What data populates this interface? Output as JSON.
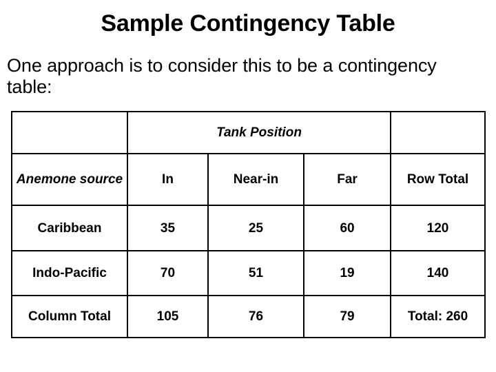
{
  "slide": {
    "title": "Sample Contingency Table",
    "body": "One approach is to consider this to be a contingency table:"
  },
  "accent_colors": {
    "total_red": "#cc1122",
    "text_black": "#000000",
    "border_black": "#000000",
    "background": "#ffffff"
  },
  "table": {
    "group_header": {
      "corner": "",
      "tank_position": "Tank Position",
      "corner_right": ""
    },
    "column_headers": {
      "stub": "Anemone source",
      "in": "In",
      "near_in": "Near-in",
      "far": "Far",
      "row_total": "Row Total"
    },
    "rows": [
      {
        "label": "Caribbean",
        "in": "35",
        "near_in": "25",
        "far": "60",
        "row_total": "120"
      },
      {
        "label": "Indo-Pacific",
        "in": "70",
        "near_in": "51",
        "far": "19",
        "row_total": "140"
      }
    ],
    "footer": {
      "label": "Column Total",
      "in": "105",
      "near_in": "76",
      "far": "79",
      "grand_total": "Total: 260"
    }
  },
  "chart_data": {
    "type": "table",
    "title": "Sample Contingency Table",
    "row_variable": "Anemone source",
    "column_variable": "Tank Position",
    "categories": [
      "In",
      "Near-in",
      "Far"
    ],
    "row_categories": [
      "Caribbean",
      "Indo-Pacific"
    ],
    "series": [
      {
        "name": "Caribbean",
        "values": [
          35,
          25,
          60
        ],
        "row_total": 120
      },
      {
        "name": "Indo-Pacific",
        "values": [
          70,
          51,
          19
        ],
        "row_total": 140
      }
    ],
    "column_totals": [
      105,
      76,
      79
    ],
    "grand_total": 260
  }
}
